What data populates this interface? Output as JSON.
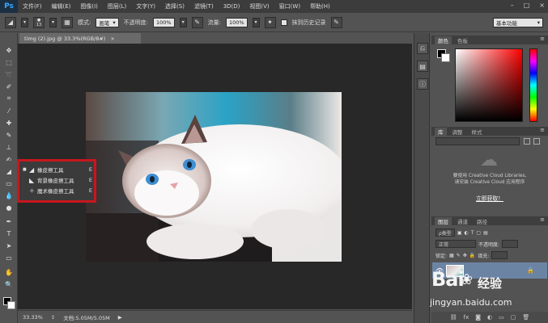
{
  "app": {
    "logo": "Ps"
  },
  "menu": [
    "文件(F)",
    "编辑(E)",
    "图像(I)",
    "图层(L)",
    "文字(Y)",
    "选择(S)",
    "滤镜(T)",
    "3D(D)",
    "视图(V)",
    "窗口(W)",
    "帮助(H)"
  ],
  "window_controls": [
    "–",
    "□",
    "×"
  ],
  "options": {
    "brush_size": "13",
    "mode_label": "模式:",
    "mode_value": "画笔",
    "opacity_label": "不透明度:",
    "opacity_value": "100%",
    "flow_label": "流量:",
    "flow_value": "100%",
    "history_label": "抹到历史记录",
    "workspace": "基本功能"
  },
  "document": {
    "tab_title": "timg (2).jpg @ 33.3%(RGB/8#)",
    "close": "×",
    "zoom": "33.33%",
    "doc_info": "文档:5.05M/5.05M"
  },
  "tools": [
    "move-icon",
    "marquee-icon",
    "lasso-icon",
    "quick-select-icon",
    "crop-icon",
    "eyedropper-icon",
    "healing-icon",
    "brush-icon",
    "stamp-icon",
    "history-brush-icon",
    "eraser-icon",
    "gradient-icon",
    "blur-icon",
    "dodge-icon",
    "pen-icon",
    "type-icon",
    "path-select-icon",
    "shape-icon",
    "hand-icon",
    "zoom-icon"
  ],
  "flyout": [
    {
      "label": "橡皮擦工具",
      "key": "E",
      "active": true
    },
    {
      "label": "背景橡皮擦工具",
      "key": "E",
      "active": false
    },
    {
      "label": "魔术橡皮擦工具",
      "key": "E",
      "active": false
    }
  ],
  "panels": {
    "color_tabs": [
      "颜色",
      "色板"
    ],
    "library_tabs": [
      "库",
      "调整",
      "样式"
    ],
    "library_msg_1": "要使用 Creative Cloud Libraries,",
    "library_msg_2": "请安装 Creative Cloud 应用程序",
    "library_link": "立即获取！",
    "layer_tabs": [
      "图层",
      "通道",
      "路径"
    ],
    "filter_kind": "ρ类型",
    "blend_mode": "正常",
    "opacity_label": "不透明度:",
    "lock_label": "锁定:",
    "fill_label": "填充:"
  },
  "watermark": {
    "brand": "Bai",
    "brand2": "经验",
    "url": "jingyan.baidu.com"
  },
  "colors": {
    "accent": "#c8161e",
    "selection": "#6b84a4",
    "canvas": "#282828"
  }
}
